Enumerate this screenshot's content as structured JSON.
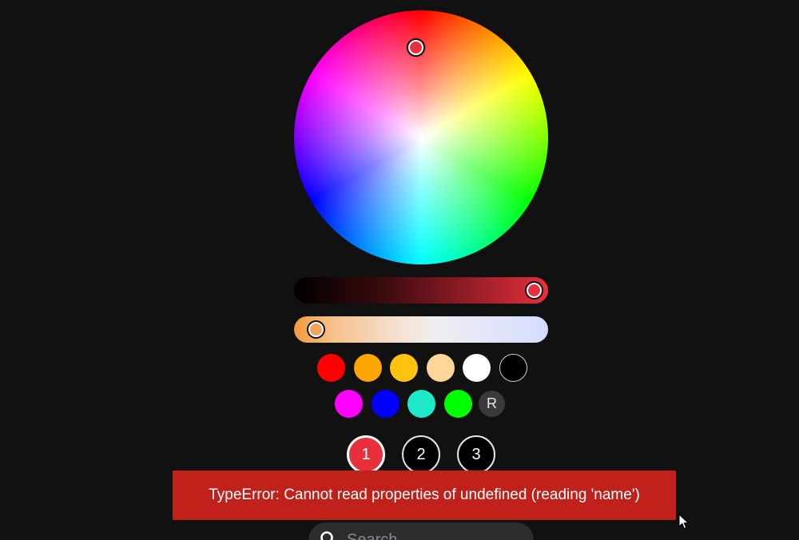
{
  "color_picker": {
    "selected_color": "#e8303d",
    "brightness_fill_color": "#e8303d",
    "temperature_handle_color": "#f4a35a"
  },
  "swatches_row1": [
    {
      "name": "swatch-red",
      "color": "#ff0000"
    },
    {
      "name": "swatch-orange",
      "color": "#ffa500"
    },
    {
      "name": "swatch-gold",
      "color": "#ffc20e"
    },
    {
      "name": "swatch-peach",
      "color": "#ffd59a"
    },
    {
      "name": "swatch-white",
      "color": "#ffffff"
    },
    {
      "name": "swatch-black",
      "color": "#000000"
    }
  ],
  "swatches_row2": [
    {
      "name": "swatch-magenta",
      "color": "#ff00ff"
    },
    {
      "name": "swatch-blue",
      "color": "#0000ff"
    },
    {
      "name": "swatch-turquoise",
      "color": "#1de9c8"
    },
    {
      "name": "swatch-green",
      "color": "#00ff00"
    }
  ],
  "reset_label": "R",
  "presets": [
    {
      "label": "1",
      "active": true
    },
    {
      "label": "2",
      "active": false
    },
    {
      "label": "3",
      "active": false
    }
  ],
  "error_toast": {
    "message": "TypeError: Cannot read properties of undefined (reading 'name')"
  },
  "search": {
    "placeholder": "Search"
  },
  "icons": {
    "search": "search-icon",
    "cursor": "mouse-pointer-icon"
  }
}
